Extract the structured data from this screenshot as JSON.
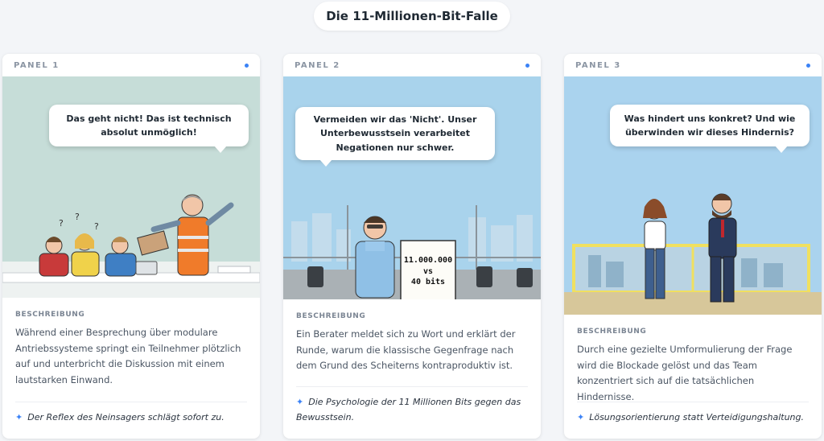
{
  "page": {
    "title": "Die 11-Millionen-Bit-Falle"
  },
  "panels": [
    {
      "label": "PANEL 1",
      "bubble": "Das geht nicht! Das ist technisch absolut unmöglich!",
      "section_label": "BESCHREIBUNG",
      "description": "Während einer Besprechung über modulare Antriebssysteme springt ein Teilnehmer plötzlich auf und unterbricht die Diskussion mit einem lautstarken Einwand.",
      "takeaway": "Der Reflex des Neinsagers schlägt sofort zu.",
      "scene_colors": {
        "sky": "#c6ddd8",
        "table": "#ffffff"
      }
    },
    {
      "label": "PANEL 2",
      "bubble": "Vermeiden wir das 'Nicht'. Unser Unterbewusstsein verarbeitet Negationen nur schwer.",
      "flipchart": {
        "line1": "11.000.000",
        "line2": "vs",
        "line3": "40 bits"
      },
      "section_label": "BESCHREIBUNG",
      "description": "Ein Berater meldet sich zu Wort und erklärt der Runde, warum die klassische Gegenfrage nach dem Grund des Scheiterns kontraproduktiv ist.",
      "takeaway": "Die Psychologie der 11 Millionen Bits gegen das Bewusstsein.",
      "scene_colors": {
        "sky": "#a9d3ec",
        "floor": "#9aa3a8"
      }
    },
    {
      "label": "PANEL 3",
      "bubble": "Was hindert uns konkret? Und wie überwinden wir dieses Hindernis?",
      "section_label": "BESCHREIBUNG",
      "description": "Durch eine gezielte Umformulierung der Frage wird die Blockade gelöst und das Team konzentriert sich auf die tatsächlichen Hindernisse.",
      "takeaway": "Lösungsorientierung statt Verteidigungshaltung.",
      "scene_colors": {
        "sky": "#aad3ee",
        "window_frame": "#f0e060"
      }
    }
  ],
  "icons": {
    "takeaway": "sparkle-icon",
    "status": "dot-indicator"
  },
  "colors": {
    "accent": "#3b82f6",
    "background": "#f3f5f8"
  }
}
